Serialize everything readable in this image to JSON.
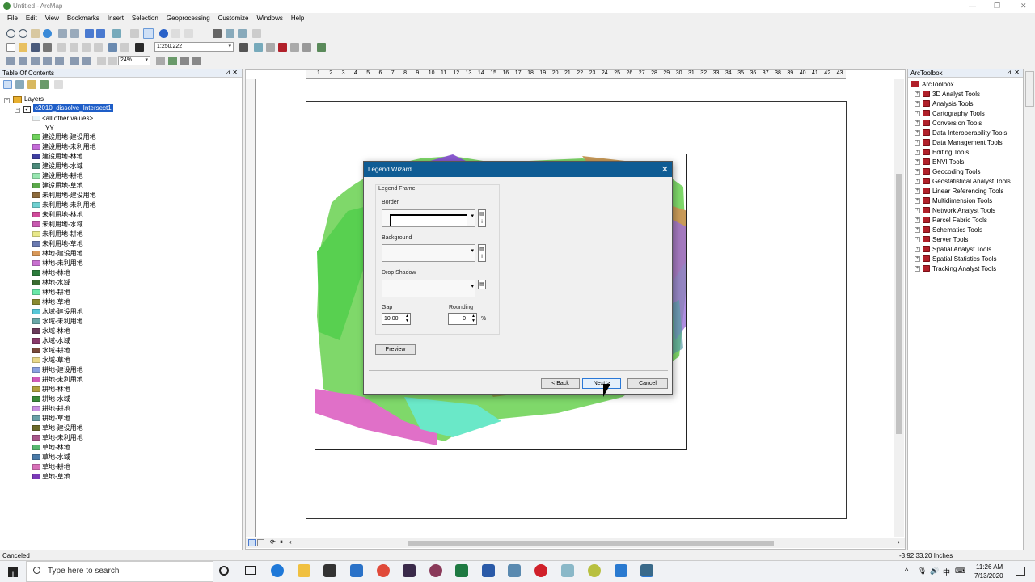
{
  "window": {
    "title": "Untitled - ArcMap"
  },
  "menu": [
    "File",
    "Edit",
    "View",
    "Bookmarks",
    "Insert",
    "Selection",
    "Geoprocessing",
    "Customize",
    "Windows",
    "Help"
  ],
  "toolbar": {
    "scale": "1:250,222",
    "zoom": "24%"
  },
  "toc": {
    "title": "Table Of Contents",
    "root": "Layers",
    "layer": "c2010_dissolve_Intersect1",
    "other_values": "<all other values>",
    "field": "YY",
    "legend": [
      {
        "label": "建设用地-建设用地",
        "color": "#6fd25c"
      },
      {
        "label": "建设用地-未利用地",
        "color": "#c46bd8"
      },
      {
        "label": "建设用地-林地",
        "color": "#3f3fa0"
      },
      {
        "label": "建设用地-水域",
        "color": "#4c8a7a"
      },
      {
        "label": "建设用地-耕地",
        "color": "#98e6b0"
      },
      {
        "label": "建设用地-草地",
        "color": "#5aa84a"
      },
      {
        "label": "未利用地-建设用地",
        "color": "#8c6a3c"
      },
      {
        "label": "未利用地-未利用地",
        "color": "#6fd0d0"
      },
      {
        "label": "未利用地-林地",
        "color": "#d04a9a"
      },
      {
        "label": "未利用地-水域",
        "color": "#c85ab0"
      },
      {
        "label": "未利用地-耕地",
        "color": "#e8e88a"
      },
      {
        "label": "未利用地-草地",
        "color": "#6a7ab0"
      },
      {
        "label": "林地-建设用地",
        "color": "#d89858"
      },
      {
        "label": "林地-未利用地",
        "color": "#c870d0"
      },
      {
        "label": "林地-林地",
        "color": "#2c7c3c"
      },
      {
        "label": "林地-水域",
        "color": "#3a6a30"
      },
      {
        "label": "林地-耕地",
        "color": "#6ae8a8"
      },
      {
        "label": "林地-草地",
        "color": "#8a8a30"
      },
      {
        "label": "水域-建设用地",
        "color": "#58c8d8"
      },
      {
        "label": "水域-未利用地",
        "color": "#6aa8a8"
      },
      {
        "label": "水域-林地",
        "color": "#6a3a5a"
      },
      {
        "label": "水域-水域",
        "color": "#8a3a6a"
      },
      {
        "label": "水域-耕地",
        "color": "#7a4a3a"
      },
      {
        "label": "水域-草地",
        "color": "#e8d88a"
      },
      {
        "label": "耕地-建设用地",
        "color": "#8aa0e0"
      },
      {
        "label": "耕地-未利用地",
        "color": "#d05ab8"
      },
      {
        "label": "耕地-林地",
        "color": "#b0a040"
      },
      {
        "label": "耕地-水域",
        "color": "#3a8a3a"
      },
      {
        "label": "耕地-耕地",
        "color": "#c890e0"
      },
      {
        "label": "耕地-草地",
        "color": "#6aa0a8"
      },
      {
        "label": "草地-建设用地",
        "color": "#6a6a2a"
      },
      {
        "label": "草地-未利用地",
        "color": "#a8588a"
      },
      {
        "label": "草地-林地",
        "color": "#58b870"
      },
      {
        "label": "草地-水域",
        "color": "#4a7aa8"
      },
      {
        "label": "草地-耕地",
        "color": "#d870b8"
      },
      {
        "label": "草地-草地",
        "color": "#7a3ab8"
      }
    ]
  },
  "ruler": {
    "top_ticks": [
      "1",
      "2",
      "3",
      "4",
      "5",
      "6",
      "7",
      "8",
      "9",
      "10",
      "11",
      "12",
      "13",
      "14",
      "15",
      "16",
      "17",
      "18",
      "19",
      "20",
      "21",
      "22",
      "23",
      "24",
      "25",
      "26",
      "27",
      "28",
      "29",
      "30",
      "31",
      "32",
      "33",
      "34",
      "35",
      "36",
      "37",
      "38",
      "39",
      "40",
      "41",
      "42",
      "43"
    ]
  },
  "dialog": {
    "title": "Legend Wizard",
    "group": "Legend Frame",
    "border_label": "Border",
    "background_label": "Background",
    "shadow_label": "Drop Shadow",
    "gap_label": "Gap",
    "gap_value": "10.00",
    "rounding_label": "Rounding",
    "rounding_value": "0",
    "rounding_unit": "%",
    "preview": "Preview",
    "back": "< Back",
    "next": "Next >",
    "cancel": "Cancel"
  },
  "toolbox": {
    "title": "ArcToolbox",
    "root": "ArcToolbox",
    "items": [
      "3D Analyst Tools",
      "Analysis Tools",
      "Cartography Tools",
      "Conversion Tools",
      "Data Interoperability Tools",
      "Data Management Tools",
      "Editing Tools",
      "ENVI Tools",
      "Geocoding Tools",
      "Geostatistical Analyst Tools",
      "Linear Referencing Tools",
      "Multidimension Tools",
      "Network Analyst Tools",
      "Parcel Fabric Tools",
      "Schematics Tools",
      "Server Tools",
      "Spatial Analyst Tools",
      "Spatial Statistics Tools",
      "Tracking Analyst Tools"
    ]
  },
  "status": {
    "left": "Canceled",
    "coords": "-3.92  33.20 Inches"
  },
  "taskbar": {
    "search_placeholder": "Type here to search",
    "time": "11:26 AM",
    "date": "7/13/2020",
    "ime": "中"
  }
}
